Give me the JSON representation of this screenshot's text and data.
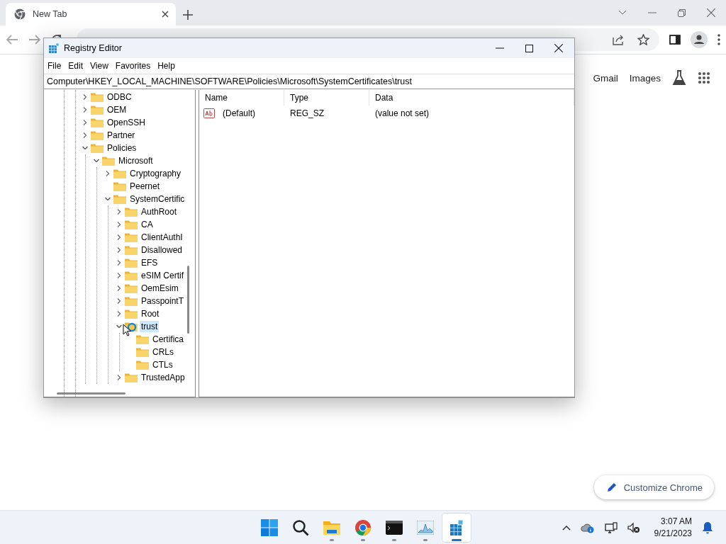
{
  "browser": {
    "tabs": [
      {
        "title": "New Tab",
        "selected": true
      }
    ],
    "page_links": [
      "Gmail",
      "Images"
    ],
    "customize_button": "Customize Chrome"
  },
  "registry_editor": {
    "title": "Registry Editor",
    "menu": [
      "File",
      "Edit",
      "View",
      "Favorites",
      "Help"
    ],
    "address": "Computer\\HKEY_LOCAL_MACHINE\\SOFTWARE\\Policies\\Microsoft\\SystemCertificates\\trust",
    "tree": [
      {
        "label": "ODBC",
        "expanded": false,
        "selected": false
      },
      {
        "label": "OEM",
        "expanded": false,
        "selected": false
      },
      {
        "label": "OpenSSH",
        "expanded": false,
        "selected": false
      },
      {
        "label": "Partner",
        "expanded": false,
        "selected": false
      },
      {
        "label": "Policies",
        "expanded": true,
        "selected": false,
        "children": [
          {
            "label": "Microsoft",
            "expanded": true,
            "selected": false,
            "children": [
              {
                "label": "Cryptography",
                "expanded": false,
                "selected": false
              },
              {
                "label": "Peernet",
                "selected": false
              },
              {
                "label": "SystemCertific",
                "expanded": true,
                "selected": false,
                "children": [
                  {
                    "label": "AuthRoot",
                    "expanded": false,
                    "selected": false
                  },
                  {
                    "label": "CA",
                    "expanded": false,
                    "selected": false
                  },
                  {
                    "label": "ClientAuthI",
                    "expanded": false,
                    "selected": false
                  },
                  {
                    "label": "Disallowed",
                    "expanded": false,
                    "selected": false
                  },
                  {
                    "label": "EFS",
                    "expanded": false,
                    "selected": false
                  },
                  {
                    "label": "eSIM Certif",
                    "expanded": false,
                    "selected": false
                  },
                  {
                    "label": "OemEsim",
                    "expanded": false,
                    "selected": false
                  },
                  {
                    "label": "PasspointT",
                    "expanded": false,
                    "selected": false
                  },
                  {
                    "label": "Root",
                    "expanded": false,
                    "selected": false
                  },
                  {
                    "label": "trust",
                    "expanded": true,
                    "selected": true,
                    "children": [
                      {
                        "label": "Certifica",
                        "selected": false
                      },
                      {
                        "label": "CRLs",
                        "selected": false
                      },
                      {
                        "label": "CTLs",
                        "selected": false
                      }
                    ]
                  },
                  {
                    "label": "TrustedApp",
                    "expanded": false,
                    "selected": false
                  }
                ]
              }
            ]
          }
        ]
      }
    ],
    "columns": [
      "Name",
      "Type",
      "Data"
    ],
    "values": [
      {
        "name": "(Default)",
        "type": "REG_SZ",
        "data": "(value not set)"
      }
    ]
  },
  "taskbar": {
    "apps": [
      {
        "kind": "start",
        "running": false,
        "selected": false
      },
      {
        "kind": "search",
        "running": false,
        "selected": false
      },
      {
        "kind": "explorer",
        "running": true,
        "selected": false
      },
      {
        "kind": "chrome",
        "running": true,
        "selected": false
      },
      {
        "kind": "terminal",
        "running": true,
        "selected": false
      },
      {
        "kind": "monitor",
        "running": true,
        "selected": false
      },
      {
        "kind": "regedit",
        "running": true,
        "selected": true
      }
    ],
    "time": "3:07 AM",
    "date": "9/21/2023"
  }
}
